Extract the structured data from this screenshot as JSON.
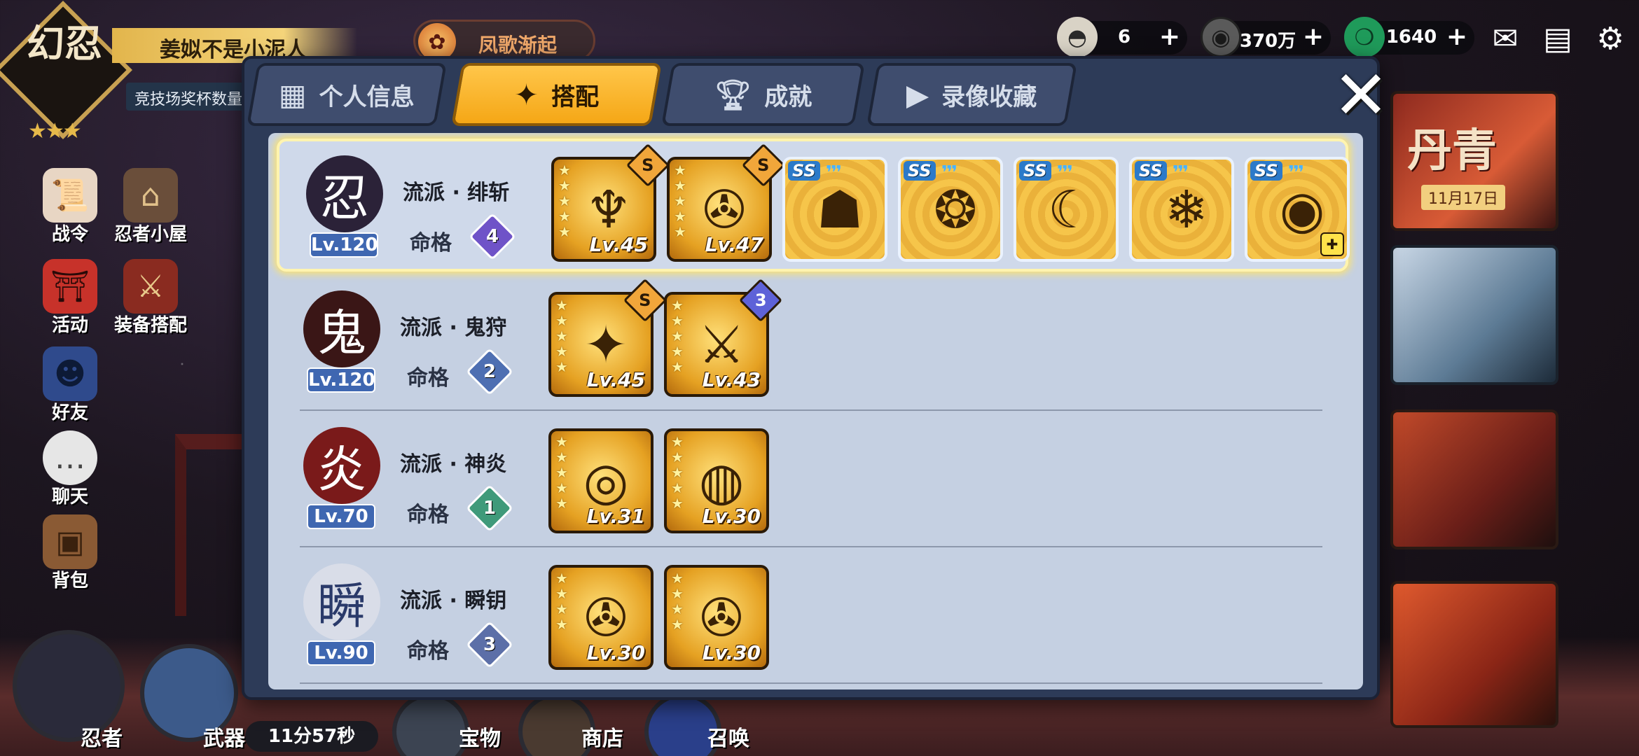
{
  "player": {
    "logo_text": "幻忍",
    "name": "姜姒不是小泥人",
    "subtitle": "竞技场奖杯数量"
  },
  "event": {
    "label": "凤歌渐起"
  },
  "currencies": [
    {
      "name": "rice-ball",
      "icon": "rice-ball-icon",
      "value": "6"
    },
    {
      "name": "coin",
      "icon": "coin-icon",
      "value": "370万"
    },
    {
      "name": "jade",
      "icon": "jade-icon",
      "value": "1640"
    }
  ],
  "side_menu": [
    {
      "id": "battle-pass",
      "label": "战令",
      "icon": "scroll-icon"
    },
    {
      "id": "ninja-house",
      "label": "忍者小屋",
      "icon": "house-icon"
    },
    {
      "id": "activity",
      "label": "活动",
      "icon": "torii-icon"
    },
    {
      "id": "equip-match",
      "label": "装备搭配",
      "icon": "equipment-icon"
    },
    {
      "id": "friends",
      "label": "好友",
      "icon": "ninja-icon"
    },
    {
      "id": "chat",
      "label": "聊天",
      "icon": "chat-icon"
    },
    {
      "id": "bag",
      "label": "背包",
      "icon": "bag-icon"
    }
  ],
  "bottom_bar": {
    "ninja_label": "忍者",
    "weapon_label": "武器",
    "treasure_label": "宝物",
    "shop_label": "商店",
    "summon_label": "召唤",
    "timer": "11分57秒"
  },
  "right_banner": {
    "text": "丹青",
    "date": "11月17日"
  },
  "tabs": [
    {
      "id": "profile",
      "label": "个人信息",
      "icon": "profile-icon",
      "active": false
    },
    {
      "id": "loadout",
      "label": "搭配",
      "icon": "shuriken-icon",
      "active": true
    },
    {
      "id": "achievement",
      "label": "成就",
      "icon": "trophy-icon",
      "active": false
    },
    {
      "id": "replay",
      "label": "录像收藏",
      "icon": "play-icon",
      "active": false
    }
  ],
  "fate_label": "命格",
  "ninjas": [
    {
      "school": "流派 · 绯斩",
      "level": "Lv.120",
      "fate": "4",
      "fate_color": "#6f53c8",
      "avatar": "ninja-avatar-purple",
      "avatar_bg": "#2b2238",
      "avatar_glyph": "忍",
      "items": [
        {
          "type": "weapon",
          "stars": 5,
          "grade": "S",
          "level": "Lv.45",
          "glyph": "♆"
        },
        {
          "type": "weapon",
          "stars": 5,
          "grade": "S",
          "level": "Lv.47",
          "glyph": "✇"
        },
        {
          "type": "treasure",
          "tag": "SS",
          "glyph": "☗"
        },
        {
          "type": "treasure",
          "tag": "SS",
          "glyph": "❂"
        },
        {
          "type": "treasure",
          "tag": "SS",
          "glyph": "☾"
        },
        {
          "type": "treasure",
          "tag": "SS",
          "glyph": "❄"
        },
        {
          "type": "treasure",
          "tag": "SS",
          "glyph": "◉",
          "corner": true
        }
      ]
    },
    {
      "school": "流派 · 鬼狩",
      "level": "Lv.120",
      "fate": "2",
      "fate_color": "#4e6fb2",
      "avatar": "ninja-avatar-oni",
      "avatar_bg": "#3a1616",
      "avatar_glyph": "鬼",
      "items": [
        {
          "type": "weapon",
          "stars": 5,
          "grade": "S",
          "level": "Lv.45",
          "glyph": "✦"
        },
        {
          "type": "weapon",
          "stars": 5,
          "grade": "3",
          "grade_blue": true,
          "level": "Lv.43",
          "glyph": "⚔"
        }
      ]
    },
    {
      "school": "流派 · 神炎",
      "level": "Lv.70",
      "fate": "1",
      "fate_color": "#3f9a7a",
      "avatar": "ninja-avatar-girl",
      "avatar_bg": "#7a1a1a",
      "avatar_glyph": "炎",
      "items": [
        {
          "type": "weapon",
          "stars": 5,
          "level": "Lv.31",
          "glyph": "◎"
        },
        {
          "type": "weapon",
          "stars": 5,
          "level": "Lv.30",
          "glyph": "◍"
        }
      ]
    },
    {
      "school": "流派 · 瞬钥",
      "level": "Lv.90",
      "fate": "3",
      "fate_color": "#5c6fa8",
      "avatar": "ninja-avatar-witch",
      "avatar_bg": "#d9dde8",
      "avatar_glyph": "瞬",
      "items": [
        {
          "type": "weapon",
          "stars": 4,
          "level": "Lv.30",
          "glyph": "✇"
        },
        {
          "type": "weapon",
          "stars": 4,
          "level": "Lv.30",
          "glyph": "✇"
        }
      ]
    }
  ]
}
